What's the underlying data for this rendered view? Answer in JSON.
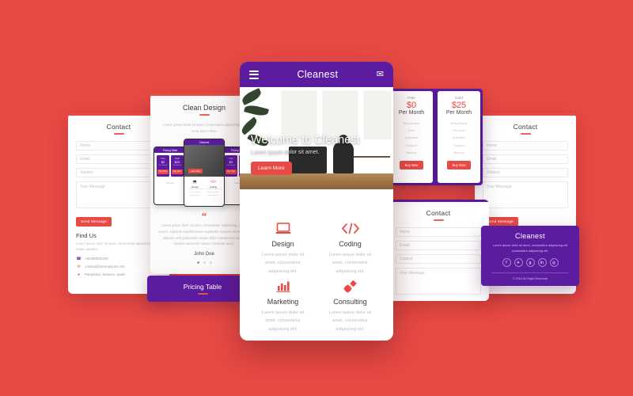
{
  "background_color": "#e84a45",
  "brand_purple": "#5b1ca0",
  "accent_red": "#e84a45",
  "mobile": {
    "header": {
      "brand": "Cleanest",
      "menu_icon": "hamburger-icon",
      "mail_icon": "envelope-icon"
    },
    "hero": {
      "heading": "Welcome to Cleanest",
      "subheading": "Lorem ipsum dolor sit amet.",
      "cta": "Learn More",
      "slides": 3,
      "active_slide": 1
    },
    "services": [
      {
        "icon": "laptop-icon",
        "glyph": "💻",
        "name": "Design",
        "desc": "Lorem ipsum dolor sit amet, consectetur adipisicing elit."
      },
      {
        "icon": "code-icon",
        "glyph": "</>",
        "name": "Coding",
        "desc": "Lorem ipsum dolor sit amet, consectetur adipisicing elit."
      },
      {
        "icon": "bar-chart-icon",
        "glyph": "📊",
        "name": "Marketing",
        "desc": "Lorem ipsum dolor sit amet, consectetur adipisicing elit."
      },
      {
        "icon": "gears-icon",
        "glyph": "⚙",
        "name": "Consulting",
        "desc": "Lorem ipsum dolor sit amet, consectetur adipisicing elit."
      }
    ]
  },
  "clean_design": {
    "title": "Clean Design",
    "subtitle": "Lorem ipsum dolor sit amet, consectetur adipisicing elit meta dolor meta.",
    "phone_labels": {
      "pricing": "Pricing Table",
      "brand": "Cleanest",
      "free": "Free",
      "gold": "Gold",
      "p0": "$0",
      "p25": "$25",
      "per": "Per Month",
      "buy": "Buy Now",
      "learn": "Learn More",
      "design": "Design",
      "coding": "Coding",
      "footer": "Cleanest"
    },
    "testimonial": {
      "quote_mark": "“",
      "text": "Lorem ipsum dolor sit amet, consectetur adipisicing. Quas earum, sapiente repellat facere explicabo maiores amet dolore aliquam velit quibusdam eaque dolor repellendus sunt id minima reiciendis neque cupiditate quod.",
      "author": "John Doe",
      "dots": 3,
      "active_dot": 1
    }
  },
  "pricing_band": {
    "title": "Pricing Table"
  },
  "pricing_cards": [
    {
      "plan": "Free",
      "amount": "$0",
      "period": "Per Month",
      "features": [
        "Responsive",
        "Free",
        "Unlimited",
        "Support",
        "Backup"
      ],
      "cta": "Buy Now"
    },
    {
      "plan": "Gold",
      "amount": "$25",
      "period": "Per Month",
      "features": [
        "Responsive",
        "Premium",
        "Unlimited",
        "Support",
        "Backup"
      ],
      "cta": "Buy Now"
    }
  ],
  "contact": {
    "title": "Contact",
    "fields": [
      {
        "name": "name-field",
        "placeholder": "Name"
      },
      {
        "name": "email-field",
        "placeholder": "Email"
      },
      {
        "name": "subject-field",
        "placeholder": "Subject"
      },
      {
        "name": "message-field",
        "placeholder": "Your Message"
      }
    ],
    "submit": "Send Message",
    "find_us_title": "Find Us",
    "find_us_text": "Lorem ipsum dolor sit amet, consectetur adipisicing. Dicta neque aperiam.",
    "phone": "+62000001200",
    "email": "contact@loremipsum.com",
    "address": "Pamplona, Navarra, Spain",
    "phone_icon": "phone-icon",
    "email_icon": "envelope-icon",
    "map_icon": "map-pin-icon"
  },
  "footer": {
    "brand": "Cleanest",
    "text": "Lorem ipsum dolor sit amet, consectetur adipisicing elit consectetur adipisicing elit.",
    "socials": [
      {
        "name": "facebook-icon",
        "glyph": "f"
      },
      {
        "name": "twitter-icon",
        "glyph": "✈"
      },
      {
        "name": "google-plus-icon",
        "glyph": "g"
      },
      {
        "name": "linkedin-icon",
        "glyph": "in"
      },
      {
        "name": "instagram-icon",
        "glyph": "◎"
      }
    ],
    "copyright": "© 2016 All Right Reserved"
  }
}
